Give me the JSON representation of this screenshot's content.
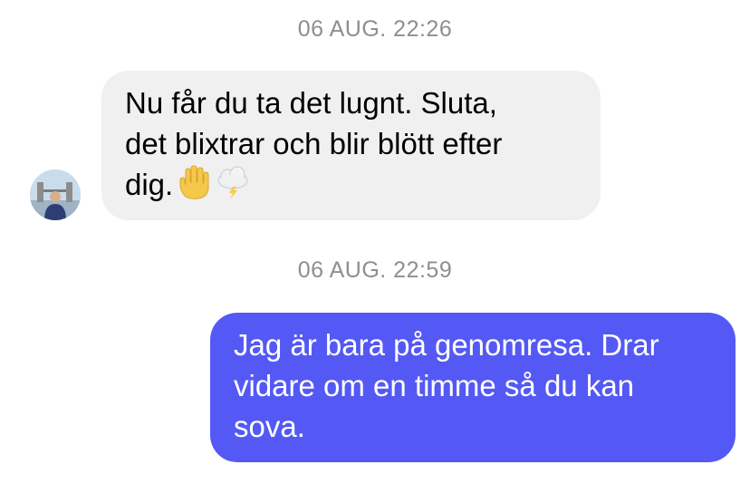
{
  "conversation": {
    "messages": [
      {
        "timestamp": "06 AUG. 22:26",
        "direction": "incoming",
        "lines": [
          "Nu får du ta det lugnt. Sluta,",
          "det blixtrar och blir blött efter",
          "dig."
        ],
        "emojis": [
          "raised-hand-icon",
          "cloud-lightning-icon"
        ]
      },
      {
        "timestamp": "06 AUG. 22:59",
        "direction": "outgoing",
        "lines": [
          "Jag är bara på genomresa. Drar",
          "vidare om en timme så du kan",
          "sova."
        ]
      }
    ]
  },
  "colors": {
    "incoming_bubble": "#f0f0f0",
    "outgoing_bubble": "#5459f5",
    "timestamp_text": "#8e8e93"
  }
}
